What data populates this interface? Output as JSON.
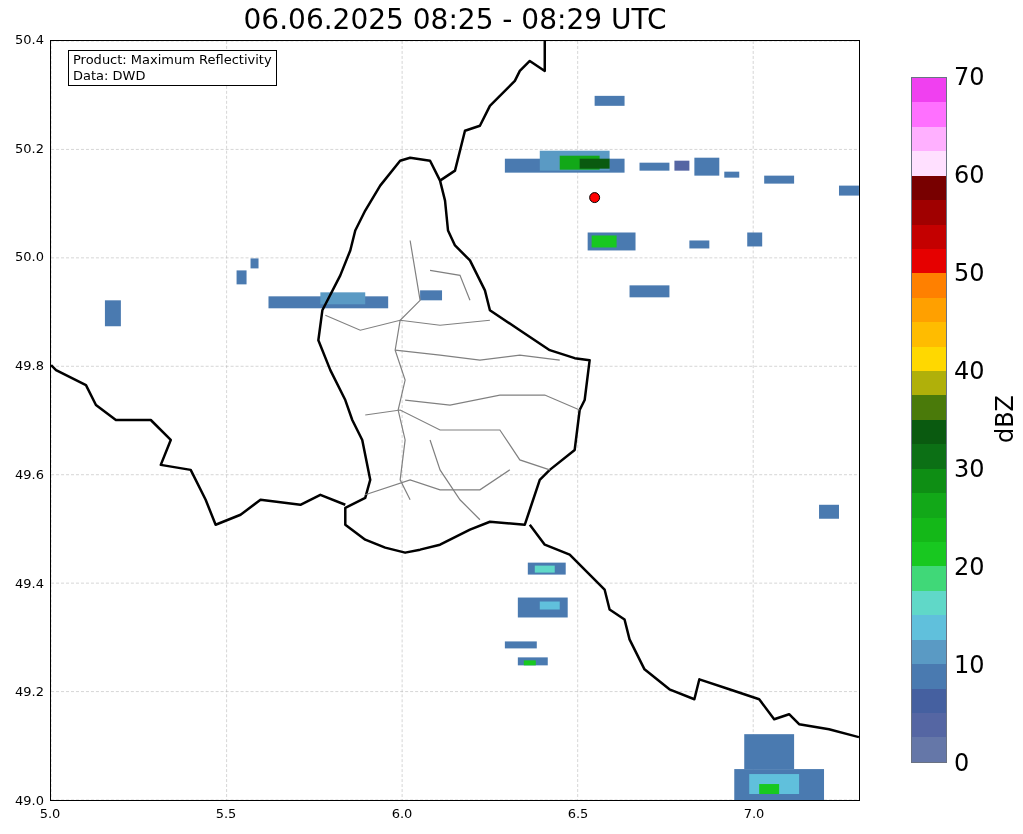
{
  "title": "06.06.2025 08:25 - 08:29 UTC",
  "info_box": [
    "Product: Maximum Reflectivity",
    "Data: DWD"
  ],
  "x_ticks": [
    "5.0",
    "5.5",
    "6.0",
    "6.5",
    "7.0"
  ],
  "y_ticks": [
    "50.4",
    "50.2",
    "50.0",
    "49.8",
    "49.6",
    "49.4",
    "49.2",
    "49.0"
  ],
  "colorbar": {
    "label": "dBZ",
    "ticks": [
      "70",
      "60",
      "50",
      "40",
      "30",
      "20",
      "10",
      "0"
    ],
    "bands": [
      {
        "color": "#f040f0"
      },
      {
        "color": "#ff70ff"
      },
      {
        "color": "#ffb0ff"
      },
      {
        "color": "#ffe0ff"
      },
      {
        "color": "#780000"
      },
      {
        "color": "#a00000"
      },
      {
        "color": "#c40000"
      },
      {
        "color": "#e60000"
      },
      {
        "color": "#ff8000"
      },
      {
        "color": "#ffa000"
      },
      {
        "color": "#ffbc00"
      },
      {
        "color": "#ffd800"
      },
      {
        "color": "#b0b00a"
      },
      {
        "color": "#4a7a0a"
      },
      {
        "color": "#0a5a10"
      },
      {
        "color": "#0c7015"
      },
      {
        "color": "#0e8e14"
      },
      {
        "color": "#12a818"
      },
      {
        "color": "#14b818"
      },
      {
        "color": "#18c820"
      },
      {
        "color": "#40d878"
      },
      {
        "color": "#60d8c8"
      },
      {
        "color": "#60c0dc"
      },
      {
        "color": "#5a9ac4"
      },
      {
        "color": "#4a7ab0"
      },
      {
        "color": "#4560a0"
      },
      {
        "color": "#5566a3"
      },
      {
        "color": "#6577a8"
      }
    ]
  }
}
